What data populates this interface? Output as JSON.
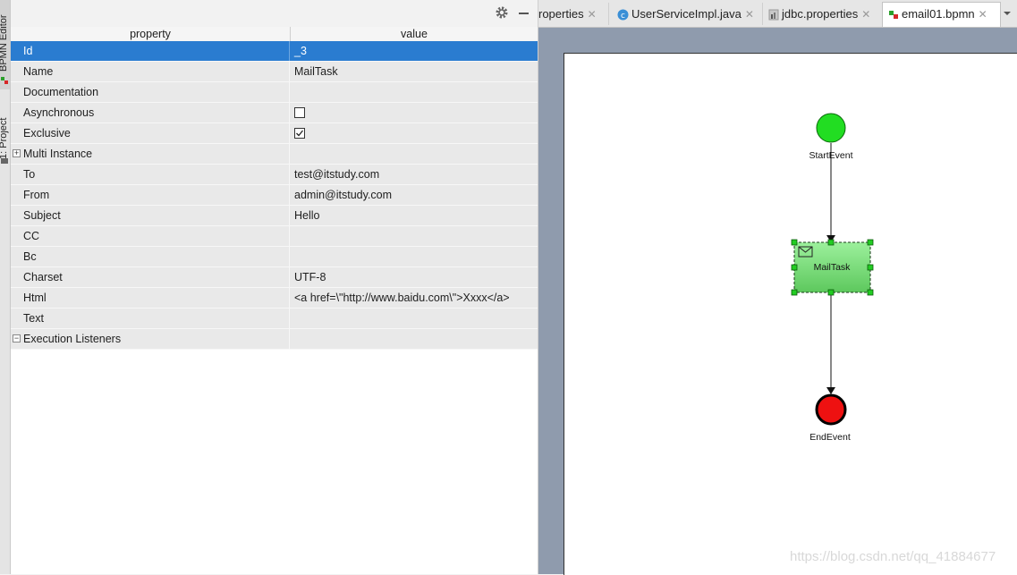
{
  "side_tabs": {
    "bpmn_editor": "BPMN Editor",
    "project": "1: Project"
  },
  "properties": {
    "header": {
      "property": "property",
      "value": "value"
    },
    "rows": [
      {
        "name": "Id",
        "value": "_3"
      },
      {
        "name": "Name",
        "value": "MailTask"
      },
      {
        "name": "Documentation",
        "value": ""
      },
      {
        "name": "Asynchronous",
        "value": "",
        "checked": false
      },
      {
        "name": "Exclusive",
        "value": "",
        "checked": true
      },
      {
        "name": "Multi Instance",
        "value": "",
        "expander": "+"
      },
      {
        "name": "To",
        "value": "test@itstudy.com"
      },
      {
        "name": "From",
        "value": "admin@itstudy.com"
      },
      {
        "name": "Subject",
        "value": "Hello"
      },
      {
        "name": "CC",
        "value": ""
      },
      {
        "name": "Bc",
        "value": ""
      },
      {
        "name": "Charset",
        "value": "UTF-8"
      },
      {
        "name": "Html",
        "value": "<a href=\\\"http://www.baidu.com\\\">Xxxx</a>"
      },
      {
        "name": "Text",
        "value": ""
      },
      {
        "name": "Execution Listeners",
        "value": "",
        "expander": "−"
      }
    ]
  },
  "tabs": [
    {
      "label": "roperties",
      "icon": "properties-file-icon"
    },
    {
      "label": "UserServiceImpl.java",
      "icon": "java-class-icon"
    },
    {
      "label": "jdbc.properties",
      "icon": "properties-file-icon"
    },
    {
      "label": "email01.bpmn",
      "icon": "bpmn-file-icon",
      "active": true
    }
  ],
  "diagram": {
    "start_label": "StartEvent",
    "task_label": "MailTask",
    "end_label": "EndEvent",
    "colors": {
      "start": "#22dd22",
      "task": "#7ee07e",
      "end": "#ee1111"
    }
  },
  "watermark": "https://blog.csdn.net/qq_41884677"
}
